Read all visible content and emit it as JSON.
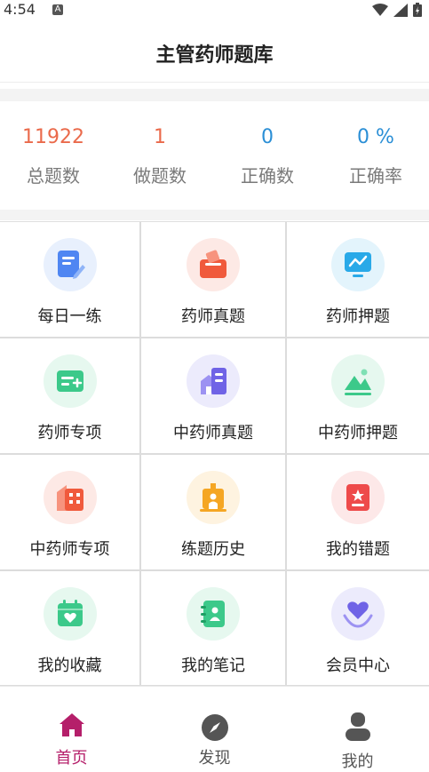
{
  "status_bar": {
    "time": "4:54",
    "sim_label": "A"
  },
  "header": {
    "title": "主管药师题库"
  },
  "stats": [
    {
      "value": "11922",
      "label": "总题数",
      "color": "#ea6a4b"
    },
    {
      "value": "1",
      "label": "做题数",
      "color": "#ea6a4b"
    },
    {
      "value": "0",
      "label": "正确数",
      "color": "#2b8fd6"
    },
    {
      "value": "0 %",
      "label": "正确率",
      "color": "#2b8fd6"
    }
  ],
  "grid": [
    {
      "label": "每日一练",
      "icon": "daily-practice-icon",
      "color": "#4f86f2",
      "bg": "#e8f0fd"
    },
    {
      "label": "药师真题",
      "icon": "real-exam-icon",
      "color": "#f05a3c",
      "bg": "#fde9e5"
    },
    {
      "label": "药师押题",
      "icon": "predicted-questions-icon",
      "color": "#29a9e8",
      "bg": "#e3f4fc"
    },
    {
      "label": "药师专项",
      "icon": "special-topic-icon",
      "color": "#3cc98a",
      "bg": "#e6f8ef"
    },
    {
      "label": "中药师真题",
      "icon": "tcm-real-exam-icon",
      "color": "#6f63e6",
      "bg": "#ecebfc"
    },
    {
      "label": "中药师押题",
      "icon": "tcm-predicted-icon",
      "color": "#3cc98a",
      "bg": "#e6f8ef"
    },
    {
      "label": "中药师专项",
      "icon": "tcm-special-topic-icon",
      "color": "#f05a3c",
      "bg": "#fde9e5"
    },
    {
      "label": "练题历史",
      "icon": "practice-history-icon",
      "color": "#f5a623",
      "bg": "#fef3e0"
    },
    {
      "label": "我的错题",
      "icon": "wrong-questions-icon",
      "color": "#ee4a4a",
      "bg": "#fde8e8"
    },
    {
      "label": "我的收藏",
      "icon": "favorites-icon",
      "color": "#3cc98a",
      "bg": "#e6f8ef"
    },
    {
      "label": "我的笔记",
      "icon": "notes-icon",
      "color": "#3cc98a",
      "bg": "#e6f8ef"
    },
    {
      "label": "会员中心",
      "icon": "member-center-icon",
      "color": "#6f63e6",
      "bg": "#ecebfc"
    }
  ],
  "tabbar": [
    {
      "label": "首页",
      "icon": "home-icon",
      "active": true,
      "color": "#b51f6a"
    },
    {
      "label": "发现",
      "icon": "compass-icon",
      "active": false,
      "color": "#555555"
    },
    {
      "label": "我的",
      "icon": "user-icon",
      "active": false,
      "color": "#555555"
    }
  ]
}
